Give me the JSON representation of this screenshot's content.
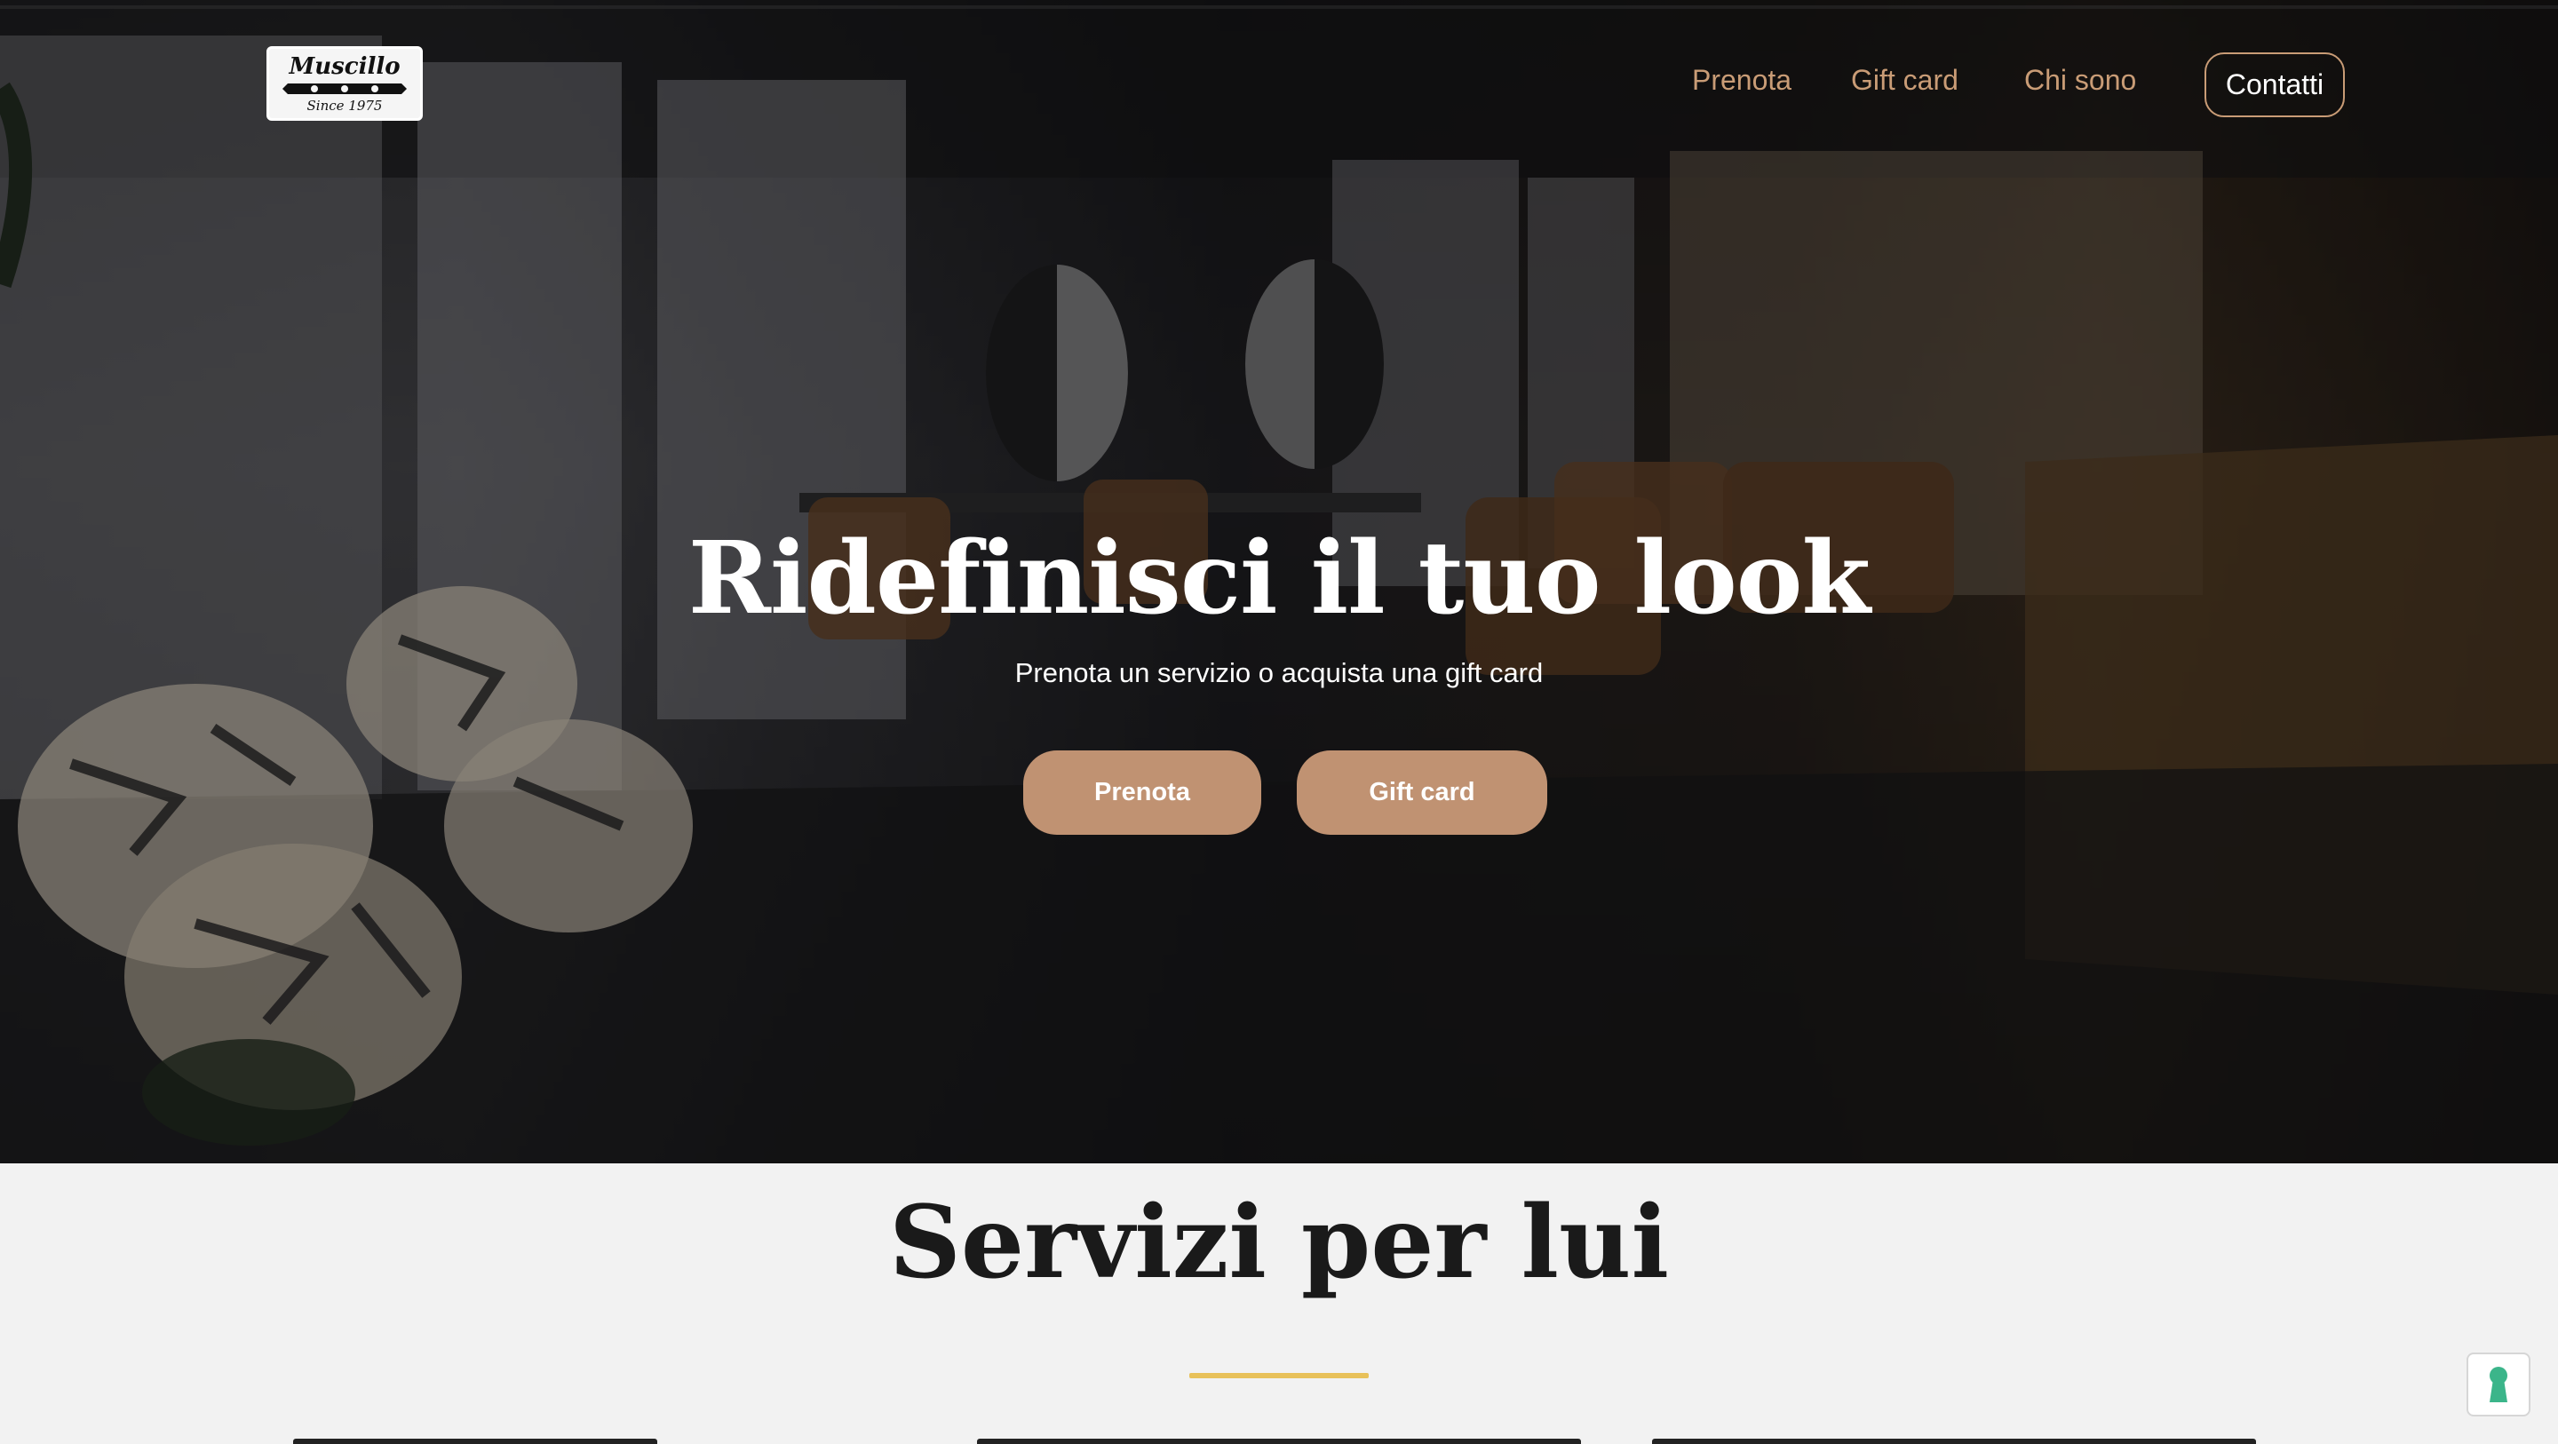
{
  "nav": {
    "logo": {
      "brand": "Muscillo",
      "since": "Since 1975"
    },
    "links": [
      {
        "label": "Prenota"
      },
      {
        "label": "Gift card"
      },
      {
        "label": "Chi sono"
      }
    ],
    "contact_label": "Contatti"
  },
  "hero": {
    "title": "Ridefinisci il tuo look",
    "subtitle": "Prenota un servizio o acquista una gift card",
    "buttons": [
      {
        "label": "Prenota"
      },
      {
        "label": "Gift card"
      }
    ]
  },
  "services": {
    "title": "Servizi per lui"
  },
  "colors": {
    "accent": "#c09272",
    "nav_link": "#c99c76",
    "divider": "#e8c15a",
    "background": "#f2f2f2"
  },
  "icons": {
    "privacy": "keyhole-icon"
  }
}
